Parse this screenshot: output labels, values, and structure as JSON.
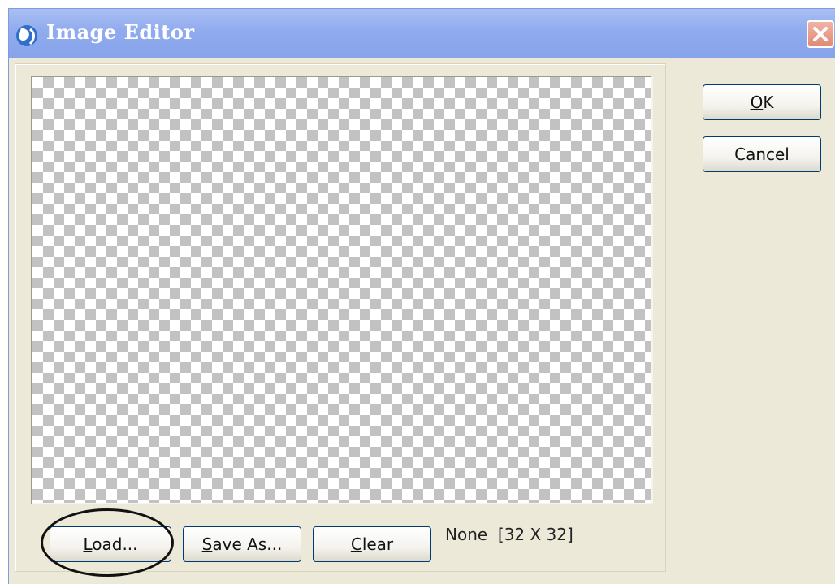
{
  "window": {
    "title": "Image Editor",
    "icon": "app-globe-icon",
    "close_icon": "close-icon",
    "accent_color": "#90abee"
  },
  "buttons": {
    "ok": {
      "mnemonic": "O",
      "rest": "K"
    },
    "cancel": {
      "label": "Cancel"
    },
    "load": {
      "mnemonic": "L",
      "rest": "oad..."
    },
    "save_as": {
      "mnemonic": "S",
      "rest": "ave As..."
    },
    "clear": {
      "mnemonic": "C",
      "rest": "lear"
    }
  },
  "image_info": "None  [32 X 32]",
  "canvas": {
    "background": "transparency-checkerboard"
  }
}
